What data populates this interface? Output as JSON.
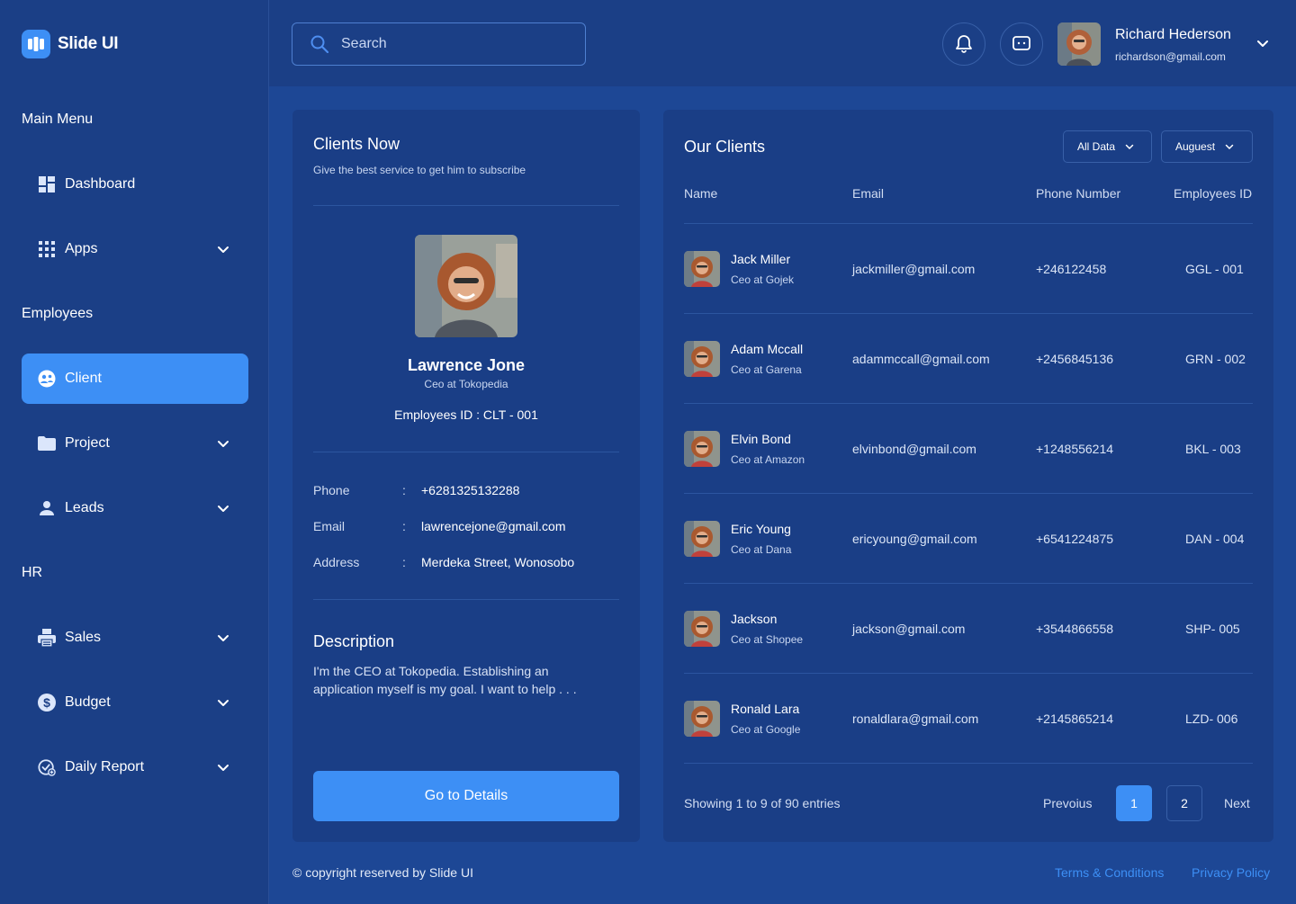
{
  "app": {
    "name": "Slide UI"
  },
  "sidebar": {
    "sections": [
      "Main Menu",
      "Employees",
      "HR"
    ],
    "items": [
      {
        "label": "Dashboard",
        "icon": "dashboard-icon",
        "has_chevron": false
      },
      {
        "label": "Apps",
        "icon": "apps-grid-icon",
        "has_chevron": true
      },
      {
        "label": "Client",
        "icon": "client-icon",
        "has_chevron": false,
        "active": true
      },
      {
        "label": "Project",
        "icon": "folder-icon",
        "has_chevron": true
      },
      {
        "label": "Leads",
        "icon": "user-icon",
        "has_chevron": true
      },
      {
        "label": "Sales",
        "icon": "printer-icon",
        "has_chevron": true
      },
      {
        "label": "Budget",
        "icon": "dollar-icon",
        "has_chevron": true
      },
      {
        "label": "Daily Report",
        "icon": "report-check-icon",
        "has_chevron": true
      }
    ]
  },
  "topbar": {
    "search_placeholder": "Search",
    "user": {
      "name": "Richard Hederson",
      "email": "richardson@gmail.com"
    }
  },
  "client_now": {
    "title": "Clients Now",
    "subtitle": "Give the best service to get him to subscribe",
    "name": "Lawrence Jone",
    "role": "Ceo at Tokopedia",
    "employee_id": "Employees ID : CLT - 001",
    "info": [
      {
        "label": "Phone",
        "colon": ":",
        "value": "+6281325132288"
      },
      {
        "label": "Email",
        "colon": ":",
        "value": "lawrencejone@gmail.com"
      },
      {
        "label": "Address",
        "colon": ":",
        "value": "Merdeka Street, Wonosobo"
      }
    ],
    "description_title": "Description",
    "description": "I'm the CEO at Tokopedia. Establishing an application myself is my goal. I want to help  . . .",
    "button": "Go to Details"
  },
  "our_clients": {
    "title": "Our Clients",
    "filters": [
      "All Data",
      "Auguest"
    ],
    "columns": [
      "Name",
      "Email",
      "Phone Number",
      "Employees ID"
    ],
    "rows": [
      {
        "name": "Jack Miller",
        "role": "Ceo at Gojek",
        "email": "jackmiller@gmail.com",
        "phone": "+246122458",
        "id": "GGL - 001"
      },
      {
        "name": "Adam Mccall",
        "role": "Ceo at Garena",
        "email": "adammccall@gmail.com",
        "phone": "+2456845136",
        "id": "GRN - 002"
      },
      {
        "name": "Elvin Bond",
        "role": "Ceo at Amazon",
        "email": "elvinbond@gmail.com",
        "phone": "+1248556214",
        "id": "BKL - 003"
      },
      {
        "name": "Eric Young",
        "role": "Ceo at Dana",
        "email": "ericyoung@gmail.com",
        "phone": "+6541224875",
        "id": "DAN - 004"
      },
      {
        "name": "Jackson",
        "role": "Ceo at Shopee",
        "email": "jackson@gmail.com",
        "phone": "+3544866558",
        "id": "SHP- 005"
      },
      {
        "name": "Ronald Lara",
        "role": "Ceo at Google",
        "email": "ronaldlara@gmail.com",
        "phone": "+2145865214",
        "id": "LZD- 006"
      }
    ],
    "showing": "Showing 1 to 9 of 90 entries",
    "pagination": {
      "prev": "Prevoius",
      "pages": [
        "1",
        "2"
      ],
      "next": "Next",
      "current": "1"
    }
  },
  "footer": {
    "copyright": "© copyright reserved by Slide UI",
    "links": [
      "Terms & Conditions",
      "Privacy Policy"
    ]
  },
  "colors": {
    "accent": "#3d8ff5",
    "background": "#1d4795",
    "panel": "#1a3e86",
    "sidebar": "#1b3f86"
  }
}
